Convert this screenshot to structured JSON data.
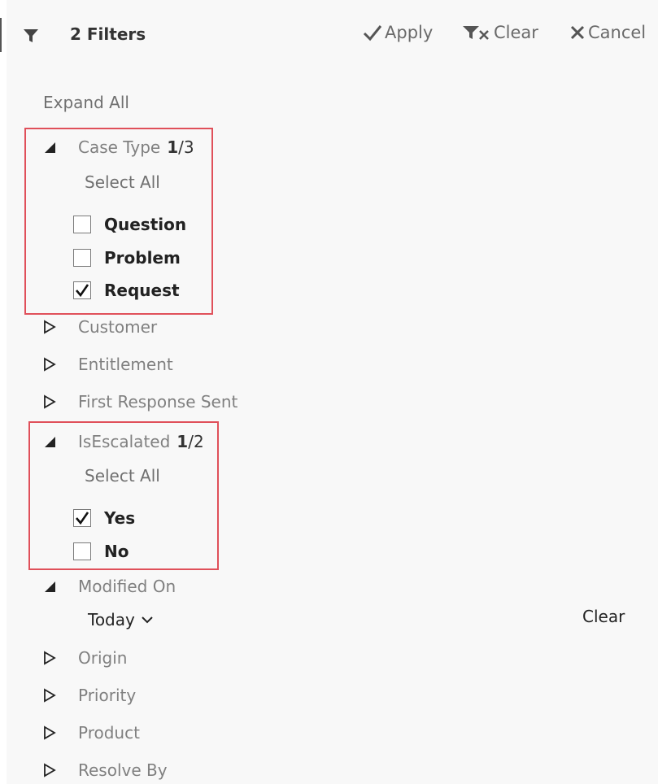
{
  "header": {
    "filter_count": "2 Filters",
    "apply_label": "Apply",
    "clear_label": "Clear",
    "cancel_label": "Cancel"
  },
  "expand_all_label": "Expand All",
  "groups": {
    "case_type": {
      "name": "Case Type",
      "selected": "1",
      "total": "/3",
      "select_all_label": "Select All",
      "options": [
        {
          "label": "Question",
          "checked": false
        },
        {
          "label": "Problem",
          "checked": false
        },
        {
          "label": "Request",
          "checked": true
        }
      ]
    },
    "customer": {
      "name": "Customer"
    },
    "entitlement": {
      "name": "Entitlement"
    },
    "first_response_sent": {
      "name": "First Response Sent"
    },
    "is_escalated": {
      "name": "IsEscalated",
      "selected": "1",
      "total": "/2",
      "select_all_label": "Select All",
      "options": [
        {
          "label": "Yes",
          "checked": true
        },
        {
          "label": "No",
          "checked": false
        }
      ]
    },
    "modified_on": {
      "name": "Modified On",
      "date_value": "Today",
      "clear_label": "Clear"
    },
    "origin": {
      "name": "Origin"
    },
    "priority": {
      "name": "Priority"
    },
    "product": {
      "name": "Product"
    },
    "resolve_by": {
      "name": "Resolve By"
    }
  },
  "icons": {
    "filter": "funnel-icon",
    "apply": "checkmark-icon",
    "clear": "funnel-x-icon",
    "cancel": "x-icon",
    "expanded": "triangle-down-right-icon",
    "collapsed": "triangle-right-outline-icon",
    "dropdown": "chevron-down-icon"
  },
  "colors": {
    "highlight": "#e0505a",
    "panel_bg": "#f8f8f8"
  }
}
